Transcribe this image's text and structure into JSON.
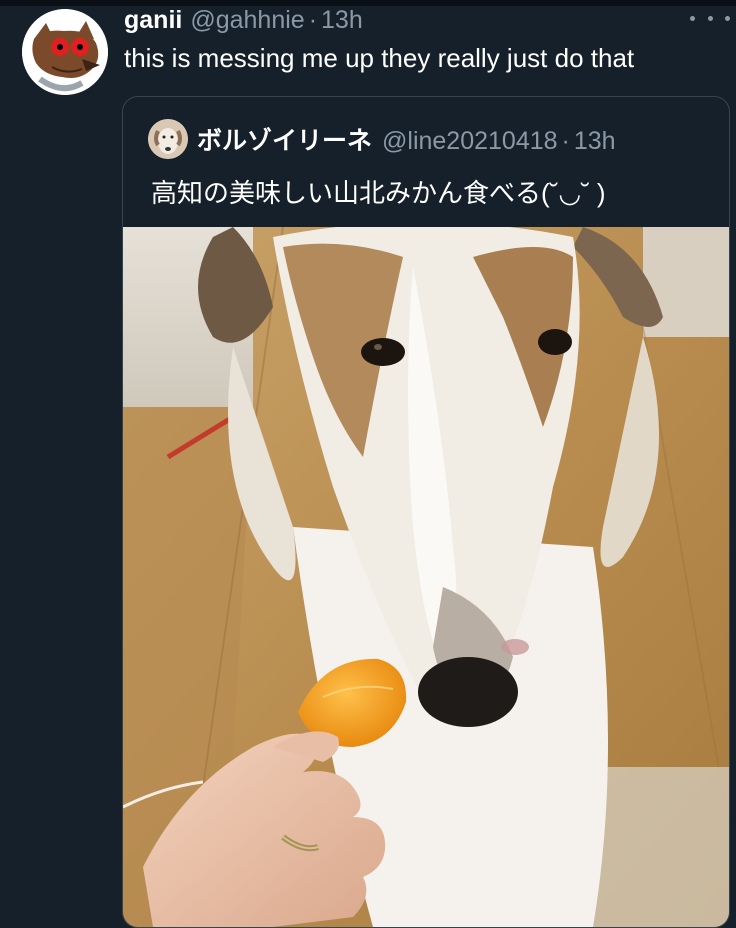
{
  "tweet": {
    "display_name": "ganii",
    "handle": "@gahhnie",
    "separator": "·",
    "time": "13h",
    "text": "this is messing me up they really just do that",
    "avatar_icon": "cartoon-wolf-avatar-icon",
    "more_icon": "more-options-icon"
  },
  "quote": {
    "display_name": "ボルゾイリーネ",
    "handle": "@line20210418",
    "separator": "·",
    "time": "13h",
    "text": "高知の美味しい山北みかん食べる(˘◡˘ )",
    "avatar_icon": "dog-avatar-icon",
    "media_icon": "borzoi-dog-with-mandarin-photo"
  },
  "colors": {
    "background": "#15202b",
    "border": "#38444d",
    "secondary_text": "#8b98a5",
    "primary_text": "#ffffff"
  }
}
